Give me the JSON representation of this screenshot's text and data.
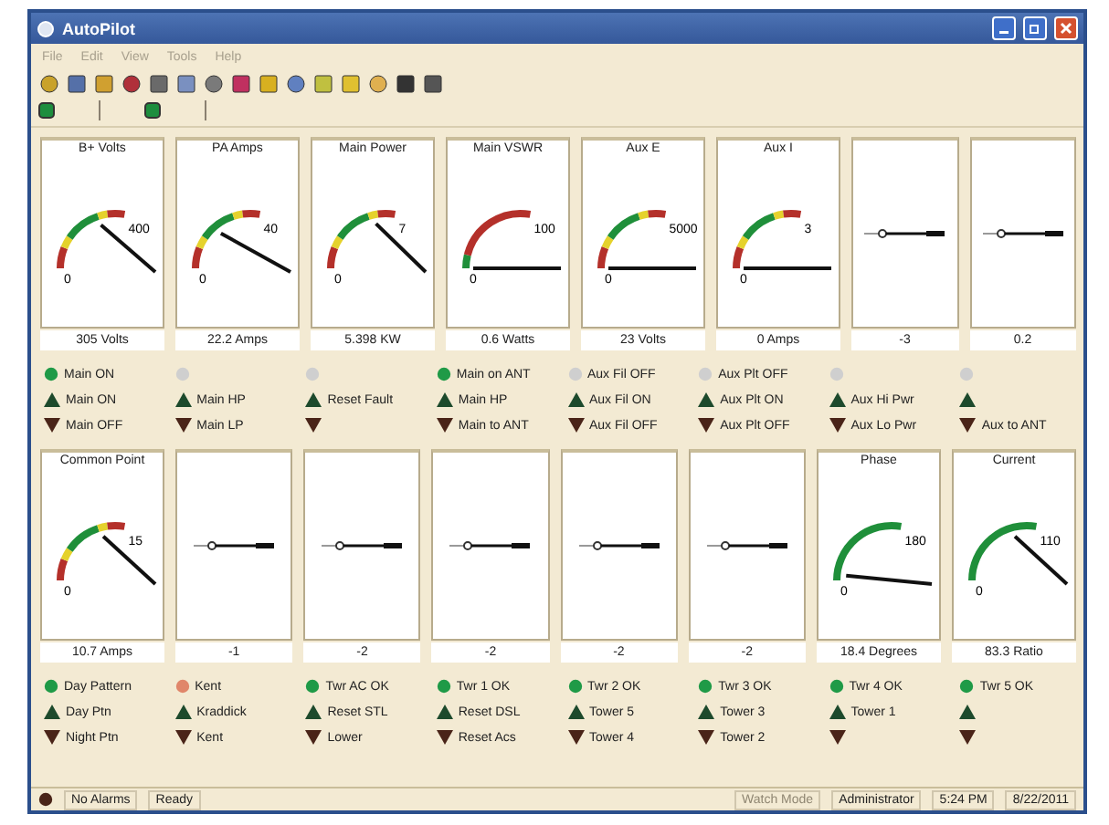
{
  "window": {
    "title": "AutoPilot"
  },
  "menu": [
    {
      "label": "File"
    },
    {
      "label": "Edit"
    },
    {
      "label": "View"
    },
    {
      "label": "Tools"
    },
    {
      "label": "Help"
    }
  ],
  "gauges": [
    {
      "kind": "bands",
      "title": "B+ Volts",
      "max": "400",
      "zero": "0",
      "reading": "305 Volts"
    },
    {
      "kind": "bands",
      "title": "PA Amps",
      "max": "40",
      "zero": "0",
      "reading": "22.2 Amps"
    },
    {
      "kind": "bands",
      "title": "Main Power",
      "max": "7",
      "zero": "0",
      "reading": "5.398 KW"
    },
    {
      "kind": "vswr",
      "title": "Main VSWR",
      "max": "100",
      "zero": "0",
      "reading": "0.6 Watts"
    },
    {
      "kind": "bands",
      "title": "Aux E",
      "max": "5000",
      "zero": "0",
      "reading": "23 Volts"
    },
    {
      "kind": "bands",
      "title": "Aux I",
      "max": "3",
      "zero": "0",
      "reading": "0 Amps"
    },
    {
      "kind": "idle",
      "reading": "-3"
    },
    {
      "kind": "idle",
      "reading": "0.2"
    }
  ],
  "controls": [
    {
      "color": "#1f9a47",
      "status": "Main ON",
      "up": "Main ON",
      "down": "Main OFF"
    },
    {
      "color": "#cfcfcf",
      "up": "Main HP",
      "down": "Main LP"
    },
    {
      "color": "#cfcfcf",
      "up": "Reset Fault"
    },
    {
      "color": "#1f9a47",
      "status": "Main on ANT",
      "up": "Main HP",
      "down": "Main to ANT"
    },
    {
      "color": "#cfcfcf",
      "status": "Aux Fil OFF",
      "up": "Aux Fil ON",
      "down": "Aux Fil OFF"
    },
    {
      "color": "#cfcfcf",
      "status": "Aux Plt OFF",
      "up": "Aux Plt ON",
      "down": "Aux Plt OFF"
    },
    {
      "color": "#cfcfcf",
      "up": "Aux Hi Pwr",
      "down": "Aux Lo Pwr"
    },
    {
      "color": "#cfcfcf",
      "down": "Aux to ANT"
    }
  ],
  "gauges_2": [
    {
      "kind": "bands",
      "title": "Common Point",
      "max": "15",
      "zero": "0",
      "reading": "10.7 Amps"
    },
    {
      "kind": "idle",
      "reading": "-1"
    },
    {
      "kind": "idle",
      "reading": "-2"
    },
    {
      "kind": "idle",
      "reading": "-2"
    },
    {
      "kind": "idle",
      "reading": "-2"
    },
    {
      "kind": "idle",
      "reading": "-2"
    },
    {
      "kind": "green",
      "title": "Phase",
      "max": "180",
      "zero": "0",
      "reading": "18.4 Degrees"
    },
    {
      "kind": "green",
      "title": "Current",
      "max": "110",
      "zero": "0",
      "reading": "83.3 Ratio"
    }
  ],
  "controls_2": [
    {
      "color": "#1f9a47",
      "status": "Day Pattern",
      "up": "Day Ptn",
      "down": "Night Ptn"
    },
    {
      "color": "#e0866a",
      "status": "Kent",
      "up": "Kraddick",
      "down": "Kent"
    },
    {
      "color": "#1f9a47",
      "status": "Twr AC OK",
      "up": "Reset STL",
      "down": "Lower"
    },
    {
      "color": "#1f9a47",
      "status": "Twr 1 OK",
      "up": "Reset DSL",
      "down": "Reset Acs"
    },
    {
      "color": "#1f9a47",
      "status": "Twr 2 OK",
      "up": "Tower 5",
      "down": "Tower 4"
    },
    {
      "color": "#1f9a47",
      "status": "Twr 3 OK",
      "up": "Tower 3",
      "down": "Tower 2"
    },
    {
      "color": "#1f9a47",
      "status": "Twr 4 OK",
      "up": "Tower 1"
    },
    {
      "color": "#1f9a47",
      "status": "Twr 5 OK"
    }
  ],
  "status_bar": {
    "alarm": "No Alarms",
    "state": "Ready",
    "mode": {
      "label": "Watch Mode",
      "disabled": true
    },
    "user": "Administrator",
    "time": "5:24 PM",
    "date": "8/22/2011"
  }
}
